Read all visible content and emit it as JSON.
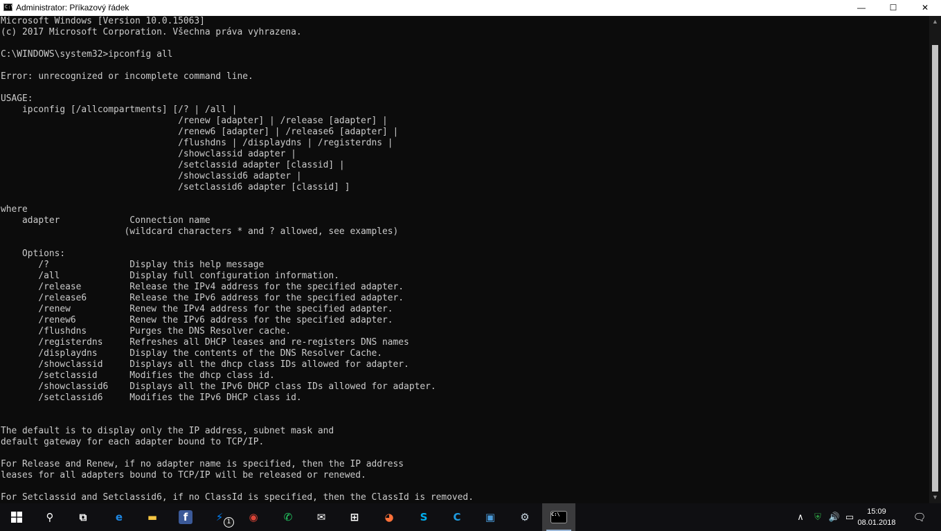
{
  "window": {
    "title": "Administrator: Příkazový řádek",
    "icon_label": "C:\\",
    "minimize_glyph": "—",
    "maximize_glyph": "☐",
    "close_glyph": "✕"
  },
  "console": {
    "lines": [
      "Microsoft Windows [Version 10.0.15063]",
      "(c) 2017 Microsoft Corporation. Všechna práva vyhrazena.",
      "",
      "C:\\WINDOWS\\system32>ipconfig all",
      "",
      "Error: unrecognized or incomplete command line.",
      "",
      "USAGE:",
      "    ipconfig [/allcompartments] [/? | /all |",
      "                                 /renew [adapter] | /release [adapter] |",
      "                                 /renew6 [adapter] | /release6 [adapter] |",
      "                                 /flushdns | /displaydns | /registerdns |",
      "                                 /showclassid adapter |",
      "                                 /setclassid adapter [classid] |",
      "                                 /showclassid6 adapter |",
      "                                 /setclassid6 adapter [classid] ]",
      "",
      "where",
      "    adapter             Connection name",
      "                       (wildcard characters * and ? allowed, see examples)",
      "",
      "    Options:",
      "       /?               Display this help message",
      "       /all             Display full configuration information.",
      "       /release         Release the IPv4 address for the specified adapter.",
      "       /release6        Release the IPv6 address for the specified adapter.",
      "       /renew           Renew the IPv4 address for the specified adapter.",
      "       /renew6          Renew the IPv6 address for the specified adapter.",
      "       /flushdns        Purges the DNS Resolver cache.",
      "       /registerdns     Refreshes all DHCP leases and re-registers DNS names",
      "       /displaydns      Display the contents of the DNS Resolver Cache.",
      "       /showclassid     Displays all the dhcp class IDs allowed for adapter.",
      "       /setclassid      Modifies the dhcp class id.",
      "       /showclassid6    Displays all the IPv6 DHCP class IDs allowed for adapter.",
      "       /setclassid6     Modifies the IPv6 DHCP class id.",
      "",
      "",
      "The default is to display only the IP address, subnet mask and",
      "default gateway for each adapter bound to TCP/IP.",
      "",
      "For Release and Renew, if no adapter name is specified, then the IP address",
      "leases for all adapters bound to TCP/IP will be released or renewed.",
      "",
      "For Setclassid and Setclassid6, if no ClassId is specified, then the ClassId is removed."
    ]
  },
  "scrollbar": {
    "up_glyph": "▲",
    "down_glyph": "▼"
  },
  "taskbar": {
    "items": [
      {
        "name": "start-button",
        "icon": "windows-logo-icon",
        "glyph": "",
        "color": "#ffffff"
      },
      {
        "name": "search-button",
        "icon": "search-icon",
        "glyph": "⚲",
        "color": "#ffffff"
      },
      {
        "name": "task-view-button",
        "icon": "task-view-icon",
        "glyph": "⧉",
        "color": "#ffffff"
      },
      {
        "name": "edge-button",
        "icon": "edge-icon",
        "glyph": "e",
        "color": "#1e88e5"
      },
      {
        "name": "file-explorer-button",
        "icon": "folder-icon",
        "glyph": "▬",
        "color": "#f4c542"
      },
      {
        "name": "facebook-button",
        "icon": "facebook-icon",
        "glyph": "f",
        "color": "#3b5998"
      },
      {
        "name": "messenger-button",
        "icon": "messenger-icon",
        "glyph": "⚡",
        "color": "#0084ff",
        "badge": "1"
      },
      {
        "name": "chrome-button",
        "icon": "chrome-icon",
        "glyph": "◉",
        "color": "#db4437"
      },
      {
        "name": "whatsapp-button",
        "icon": "whatsapp-icon",
        "glyph": "✆",
        "color": "#25d366"
      },
      {
        "name": "mail-button",
        "icon": "mail-icon",
        "glyph": "✉",
        "color": "#ffffff"
      },
      {
        "name": "store-button",
        "icon": "store-icon",
        "glyph": "⊞",
        "color": "#ffffff"
      },
      {
        "name": "firefox-button",
        "icon": "firefox-icon",
        "glyph": "◕",
        "color": "#ff7139"
      },
      {
        "name": "skype-button",
        "icon": "skype-icon",
        "glyph": "S",
        "color": "#00aff0"
      },
      {
        "name": "ccleaner-button",
        "icon": "ccleaner-icon",
        "glyph": "C",
        "color": "#1f9be0"
      },
      {
        "name": "app-button",
        "icon": "app-window-icon",
        "glyph": "▣",
        "color": "#4a9ad8"
      },
      {
        "name": "steam-button",
        "icon": "steam-icon",
        "glyph": "⚙",
        "color": "#c7d5e0"
      },
      {
        "name": "cmd-button",
        "icon": "command-prompt-icon",
        "glyph": "C:\\",
        "color": "#ffffff",
        "active": true
      }
    ],
    "tray": {
      "chevron_glyph": "∧",
      "shield_glyph": "⛨",
      "volume_glyph": "🔊",
      "network_glyph": "▭",
      "notifications_glyph": "🗨"
    },
    "time": "15:09",
    "date": "08.01.2018"
  }
}
